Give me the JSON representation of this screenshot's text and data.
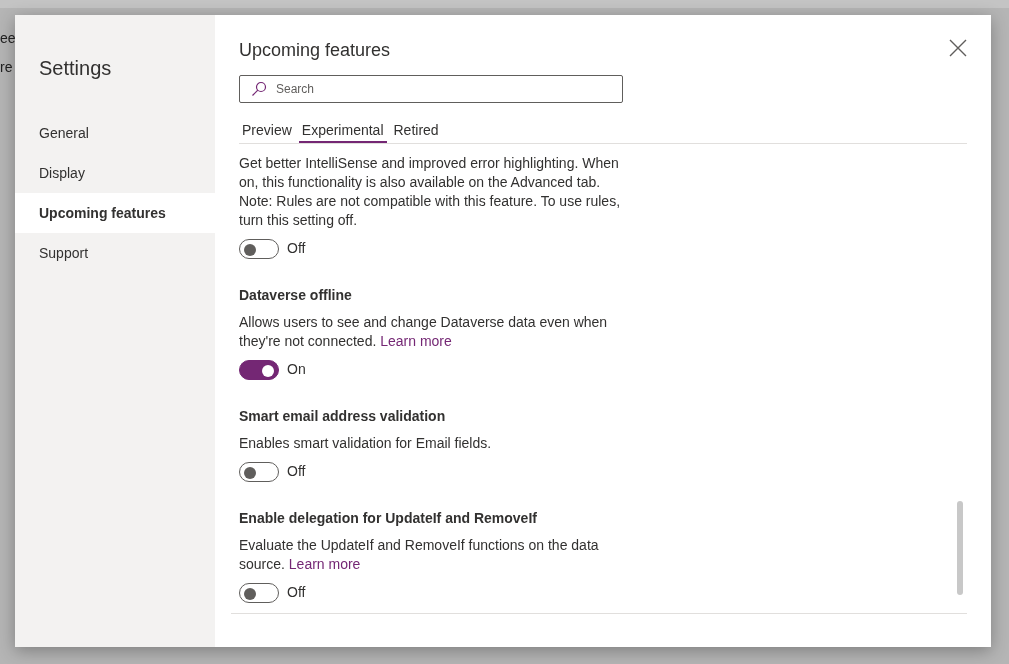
{
  "background": {
    "fragments": [
      "ee",
      "re"
    ]
  },
  "settings": {
    "title": "Settings",
    "nav": [
      {
        "label": "General",
        "selected": false
      },
      {
        "label": "Display",
        "selected": false
      },
      {
        "label": "Upcoming features",
        "selected": true
      },
      {
        "label": "Support",
        "selected": false
      }
    ]
  },
  "panel": {
    "title": "Upcoming features",
    "search": {
      "placeholder": "Search"
    },
    "tabs": [
      {
        "label": "Preview",
        "selected": false
      },
      {
        "label": "Experimental",
        "selected": true
      },
      {
        "label": "Retired",
        "selected": false
      }
    ],
    "features": [
      {
        "description": "Get better IntelliSense and improved error highlighting. When on, this functionality is also available on the Advanced tab. Note: Rules are not compatible with this feature. To use rules, turn this setting off.",
        "on": false,
        "state_label": "Off"
      },
      {
        "title": "Dataverse offline",
        "description": "Allows users to see and change Dataverse data even when they're not connected.",
        "link": "Learn more",
        "on": true,
        "state_label": "On"
      },
      {
        "title": "Smart email address validation",
        "description": "Enables smart validation for Email fields.",
        "on": false,
        "state_label": "Off"
      },
      {
        "title": "Enable delegation for UpdateIf and RemoveIf",
        "description": "Evaluate the UpdateIf and RemoveIf functions on the data source.",
        "link": "Learn more",
        "on": false,
        "state_label": "Off"
      }
    ]
  }
}
